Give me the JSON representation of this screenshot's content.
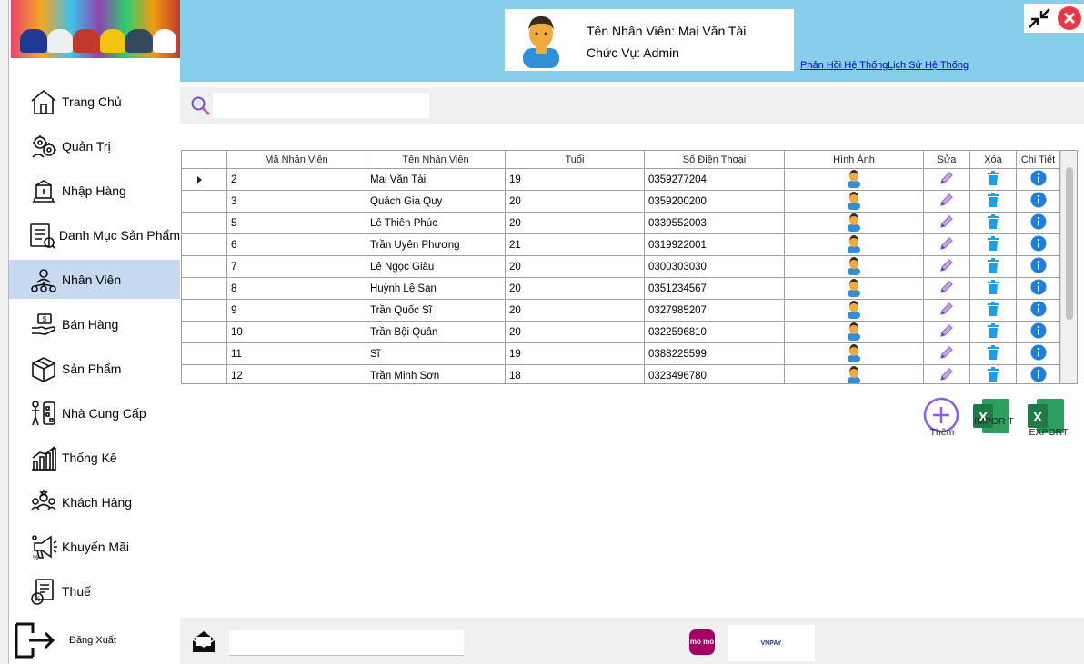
{
  "colors": {
    "header_bg": "#87ceeb",
    "active_nav": "#c5daf0",
    "close_red": "#e63946",
    "edit_purple": "#9b6bd6",
    "delete_blue": "#1e9ee8",
    "info_blue": "#1a7fe0",
    "excel_green": "#1f7a45"
  },
  "sidebar": {
    "items": [
      {
        "label": "Trang Chủ",
        "icon": "home-icon"
      },
      {
        "label": "Quản Trị",
        "icon": "admin-gears-icon"
      },
      {
        "label": "Nhập Hàng",
        "icon": "import-box-icon"
      },
      {
        "label": "Danh Mục Sản Phẩm",
        "icon": "catalog-list-icon"
      },
      {
        "label": "Nhân Viên",
        "icon": "staff-network-icon"
      },
      {
        "label": "Bán Hàng",
        "icon": "sales-hand-icon"
      },
      {
        "label": "Sản Phẩm",
        "icon": "product-box-icon"
      },
      {
        "label": "Nhà Cung Cấp",
        "icon": "supplier-icon"
      },
      {
        "label": "Thống Kê",
        "icon": "statistics-chart-icon"
      },
      {
        "label": "Khách Hàng",
        "icon": "customers-icon"
      },
      {
        "label": "Khuyến Mãi",
        "icon": "promotion-megaphone-icon"
      },
      {
        "label": "Thuế",
        "icon": "tax-document-icon"
      }
    ],
    "active_index": 4,
    "logout_label": "Đăng Xuất"
  },
  "header": {
    "user_name": "Tên Nhân Viên: Mai Văn Tài",
    "user_role": "Chức Vụ: Admin",
    "link_feedback": "Phản Hồi Hệ Thống",
    "link_history": "Lịch Sử Hệ Thống"
  },
  "search": {
    "placeholder": "",
    "value": ""
  },
  "table": {
    "columns": [
      "",
      "Mã Nhân Viên",
      "Tên Nhân Viên",
      "Tuổi",
      "Số Điện Thoại",
      "Hình Ảnh",
      "Sửa",
      "Xóa",
      "Chi Tiết"
    ],
    "rows": [
      {
        "id": "2",
        "name": "Mai Văn Tài",
        "age": "19",
        "phone": "0359277204",
        "selected": true
      },
      {
        "id": "3",
        "name": "Quách Gia Quy",
        "age": "20",
        "phone": "0359200200"
      },
      {
        "id": "5",
        "name": "Lê Thiên Phúc",
        "age": "20",
        "phone": "0339552003"
      },
      {
        "id": "6",
        "name": "Trần Uyên Phương",
        "age": "21",
        "phone": "0319922001"
      },
      {
        "id": "7",
        "name": "Lê Ngọc Giàu",
        "age": "20",
        "phone": "0300303030"
      },
      {
        "id": "8",
        "name": "Huỳnh Lệ San",
        "age": "20",
        "phone": "0351234567"
      },
      {
        "id": "9",
        "name": "Trần Quốc Sĩ",
        "age": "20",
        "phone": "0327985207"
      },
      {
        "id": "10",
        "name": "Trần Bội Quân",
        "age": "20",
        "phone": "0322596810"
      },
      {
        "id": "11",
        "name": "Sĩ",
        "age": "19",
        "phone": "0388225599"
      },
      {
        "id": "12",
        "name": "Trần Minh Sơn",
        "age": "18",
        "phone": "0323496780"
      }
    ]
  },
  "actions": {
    "add_label": "Thêm",
    "import_label": "IMPOR T",
    "export_label": "EXPORT"
  },
  "bottom": {
    "email_placeholder": "",
    "momo_label": "mo mo",
    "vnpay_label": "VNPAY"
  }
}
